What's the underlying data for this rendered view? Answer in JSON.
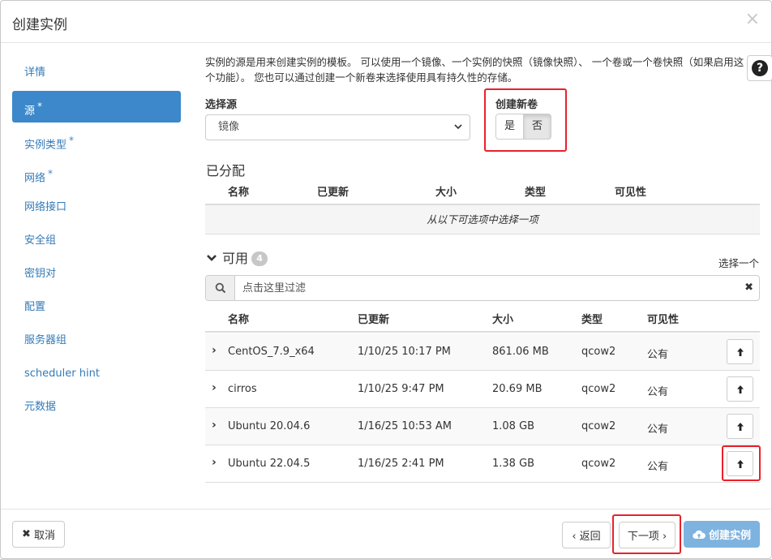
{
  "modal": {
    "title": "创建实例",
    "close": "×"
  },
  "sidebar": {
    "items": [
      {
        "label": "详情",
        "required": false
      },
      {
        "label": "源",
        "required": true,
        "active": true
      },
      {
        "label": "实例类型",
        "required": true
      },
      {
        "label": "网络",
        "required": true
      },
      {
        "label": "网络接口",
        "required": false
      },
      {
        "label": "安全组",
        "required": false
      },
      {
        "label": "密钥对",
        "required": false
      },
      {
        "label": "配置",
        "required": false
      },
      {
        "label": "服务器组",
        "required": false
      },
      {
        "label": "scheduler hint",
        "required": false
      },
      {
        "label": "元数据",
        "required": false
      }
    ],
    "required_mark": "*"
  },
  "main": {
    "help_text": "实例的源是用来创建实例的模板。 可以使用一个镜像、一个实例的快照（镜像快照）、 一个卷或一个卷快照（如果启用这个功能）。 您也可以通过创建一个新卷来选择使用具有持久性的存储。",
    "help_icon": "?",
    "select_source_label": "选择源",
    "select_source_value": "镜像",
    "create_volume_label": "创建新卷",
    "create_volume_yes": "是",
    "create_volume_no": "否",
    "allocated": {
      "title": "已分配",
      "headers": [
        "名称",
        "已更新",
        "大小",
        "类型",
        "可见性"
      ],
      "empty_text": "从以下可选项中选择一项"
    },
    "available": {
      "title": "可用",
      "count": "4",
      "pick_one": "选择一个",
      "filter_placeholder": "点击这里过滤",
      "headers": [
        "名称",
        "已更新",
        "大小",
        "类型",
        "可见性"
      ],
      "rows": [
        {
          "name": "CentOS_7.9_x64",
          "updated": "1/10/25 10:17 PM",
          "size": "861.06 MB",
          "type": "qcow2",
          "visibility": "公有"
        },
        {
          "name": "cirros",
          "updated": "1/10/25 9:47 PM",
          "size": "20.69 MB",
          "type": "qcow2",
          "visibility": "公有"
        },
        {
          "name": "Ubuntu 20.04.6",
          "updated": "1/16/25 10:53 AM",
          "size": "1.08 GB",
          "type": "qcow2",
          "visibility": "公有"
        },
        {
          "name": "Ubuntu 22.04.5",
          "updated": "1/16/25 2:41 PM",
          "size": "1.38 GB",
          "type": "qcow2",
          "visibility": "公有"
        }
      ]
    }
  },
  "footer": {
    "cancel": "取消",
    "back": "‹ 返回",
    "next": "下一项 ›",
    "create": "创建实例"
  },
  "colors": {
    "accent": "#3c88cb",
    "highlight": "#e8212b",
    "primary_disabled": "#7eb3e0"
  }
}
